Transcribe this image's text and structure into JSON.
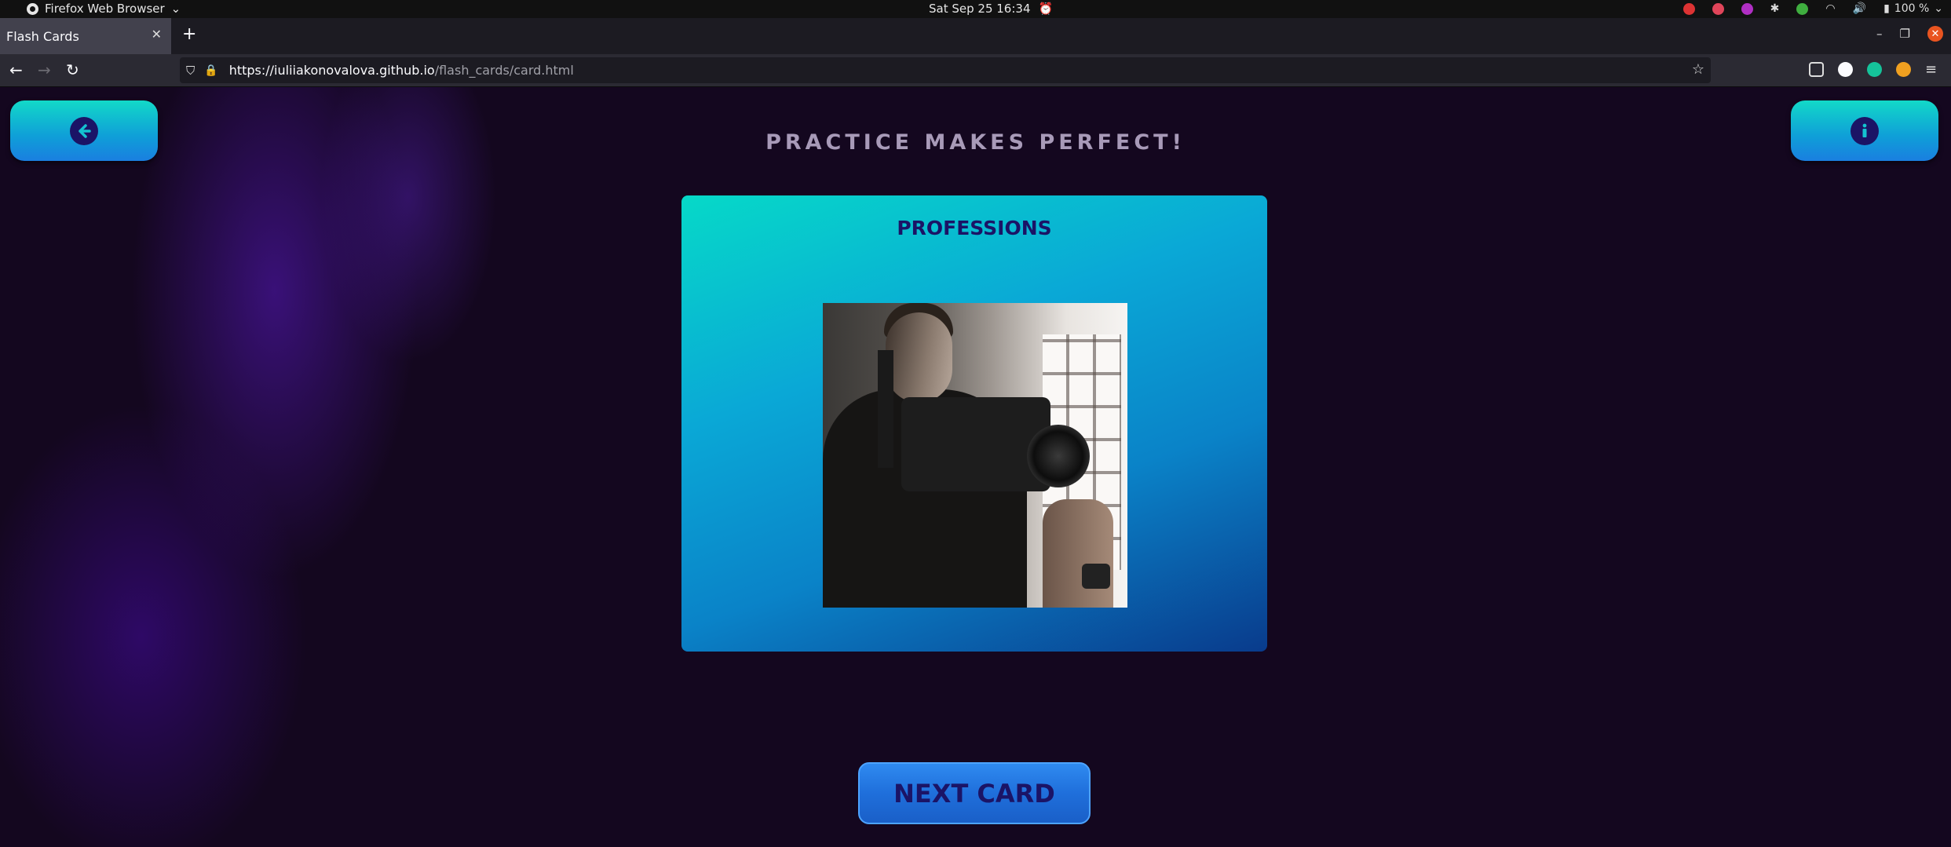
{
  "system_bar": {
    "app_name": "Firefox Web Browser",
    "datetime": "Sat Sep 25  16:34",
    "battery": "100 %"
  },
  "browser": {
    "tab_title": "Flash Cards",
    "url_host": "https://iuliiakonovalova.github.io",
    "url_path": "/flash_cards/card.html"
  },
  "page": {
    "headline": "PRACTICE MAKES PERFECT!",
    "card": {
      "category": "PROFESSIONS",
      "image_alt": "photo"
    },
    "next_button_label": "NEXT CARD",
    "back_icon": "arrow-left-icon",
    "info_icon": "info-icon"
  },
  "colors": {
    "page_background": "#14071f",
    "accent_teal": "#12d9c8",
    "button_blue": "#1f6fdb",
    "text_navy": "#1b1466",
    "headline_color": "#a89ab8"
  }
}
